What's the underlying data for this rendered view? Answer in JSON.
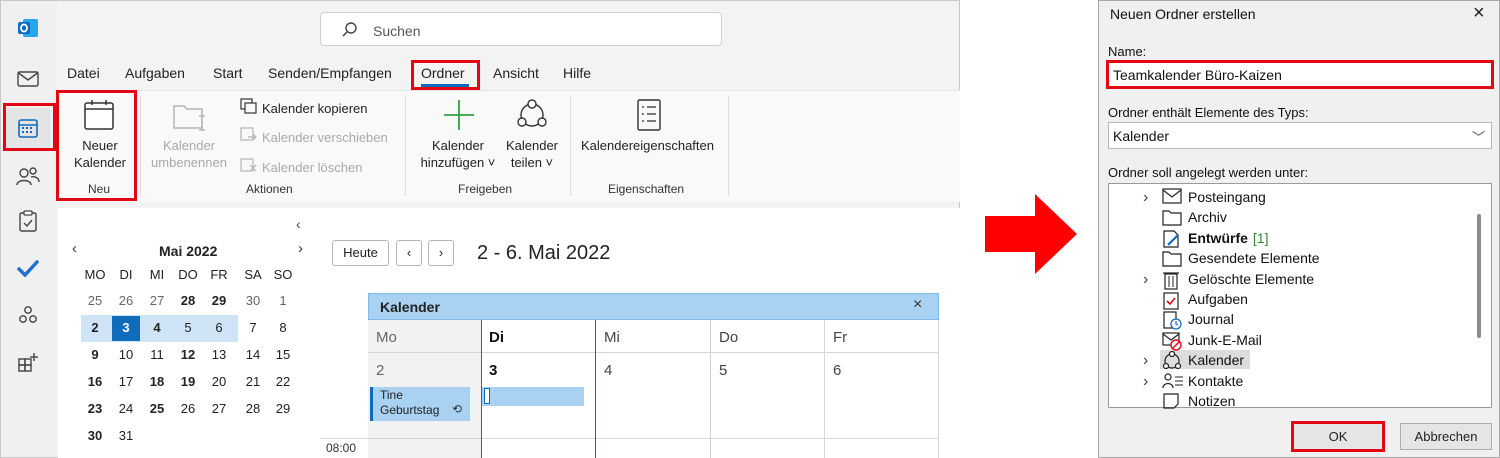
{
  "outlook": {
    "search_placeholder": "Suchen",
    "menu": [
      "Datei",
      "Aufgaben",
      "Start",
      "Senden/Empfangen",
      "Ordner",
      "Ansicht",
      "Hilfe"
    ],
    "ribbon": {
      "neuer_kalender": [
        "Neuer",
        "Kalender"
      ],
      "neu_group": "Neu",
      "umbenennen": [
        "Kalender",
        "umbenennen"
      ],
      "kopieren": "Kalender kopieren",
      "verschieben": "Kalender verschieben",
      "loeschen": "Kalender löschen",
      "aktionen_group": "Aktionen",
      "hinzufuegen": [
        "Kalender",
        "hinzufügen ˅"
      ],
      "teilen": [
        "Kalender",
        "teilen ˅"
      ],
      "freigeben_group": "Freigeben",
      "eigenschaften": "Kalendereigenschaften",
      "eigenschaften_group": "Eigenschaften"
    },
    "minical": {
      "month": "Mai 2022",
      "weekdays": [
        "MO",
        "DI",
        "MI",
        "DO",
        "FR",
        "SA",
        "SO"
      ],
      "weeks": [
        [
          "25",
          "26",
          "27",
          "28",
          "29",
          "30",
          "1"
        ],
        [
          "2",
          "3",
          "4",
          "5",
          "6",
          "7",
          "8"
        ],
        [
          "9",
          "10",
          "11",
          "12",
          "13",
          "14",
          "15"
        ],
        [
          "16",
          "17",
          "18",
          "19",
          "20",
          "21",
          "22"
        ],
        [
          "23",
          "24",
          "25",
          "26",
          "27",
          "28",
          "29"
        ],
        [
          "30",
          "31",
          "",
          "",
          "",
          "",
          ""
        ]
      ]
    },
    "calview": {
      "today_button": "Heute",
      "range": "2 - 6. Mai 2022",
      "calendar_name": "Kalender",
      "day_names": [
        "Mo",
        "Di",
        "Mi",
        "Do",
        "Fr"
      ],
      "day_numbers": [
        "2",
        "3",
        "4",
        "5",
        "6"
      ],
      "event_title": "Tine",
      "event_subtitle": "Geburtstag",
      "time_label": "08:00"
    }
  },
  "dialog": {
    "title": "Neuen Ordner erstellen",
    "name_label": "Name:",
    "name_value": "Teamkalender Büro-Kaizen",
    "type_label": "Ordner enthält Elemente des Typs:",
    "type_value": "Kalender",
    "location_label": "Ordner soll angelegt werden unter:",
    "tree": [
      {
        "label": "Posteingang",
        "icon": "inbox-icon",
        "chevron": true
      },
      {
        "label": "Archiv",
        "icon": "archive-icon",
        "chevron": false
      },
      {
        "label": "Entwürfe",
        "count": "[1]",
        "icon": "drafts-icon",
        "chevron": false,
        "bold": true
      },
      {
        "label": "Gesendete Elemente",
        "icon": "sent-icon",
        "chevron": false
      },
      {
        "label": "Gelöschte Elemente",
        "icon": "trash-icon",
        "chevron": true
      },
      {
        "label": "Aufgaben",
        "icon": "tasks-icon",
        "chevron": false
      },
      {
        "label": "Journal",
        "icon": "journal-icon",
        "chevron": false
      },
      {
        "label": "Junk-E-Mail",
        "icon": "junk-icon",
        "chevron": false
      },
      {
        "label": "Kalender",
        "icon": "calendar-share-icon",
        "chevron": true,
        "selected": true
      },
      {
        "label": "Kontakte",
        "icon": "contacts-icon",
        "chevron": true
      },
      {
        "label": "Notizen",
        "icon": "notes-icon",
        "chevron": false
      }
    ],
    "ok": "OK",
    "cancel": "Abbrechen"
  },
  "colors": {
    "accent": "#0f6cbd",
    "highlight": "#e30613",
    "selected_day": "#0f6cbd",
    "week_band": "#cfe4f7",
    "calendar_header": "#a9d1f2"
  }
}
